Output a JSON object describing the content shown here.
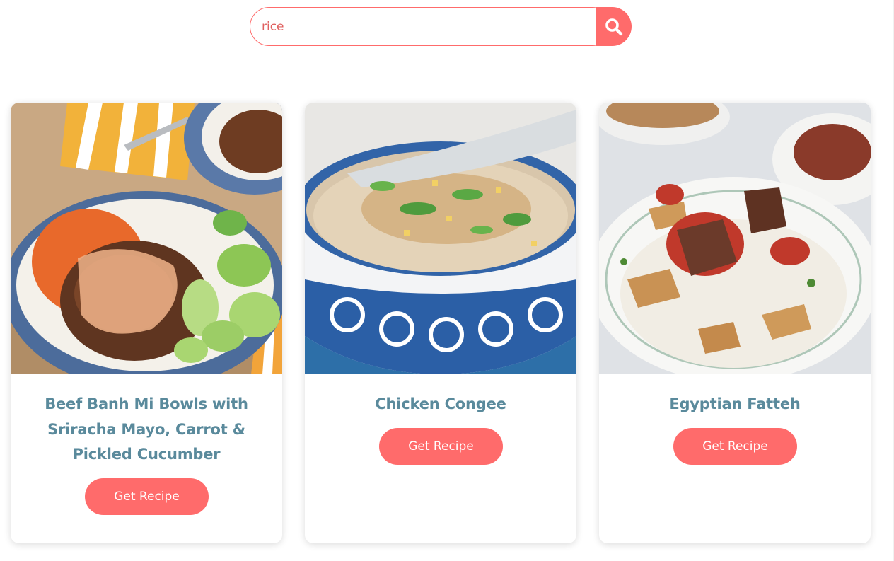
{
  "search": {
    "value": "rice",
    "button_icon": "search-icon"
  },
  "recipes": [
    {
      "title": "Beef Banh Mi Bowls with Sriracha Mayo, Carrot & Pickled Cucumber",
      "button_label": "Get Recipe"
    },
    {
      "title": "Chicken Congee",
      "button_label": "Get Recipe"
    },
    {
      "title": "Egyptian Fatteh",
      "button_label": "Get Recipe"
    }
  ],
  "colors": {
    "accent": "#ff6b6b",
    "title": "#5a8a9c",
    "background": "#ffffff"
  }
}
